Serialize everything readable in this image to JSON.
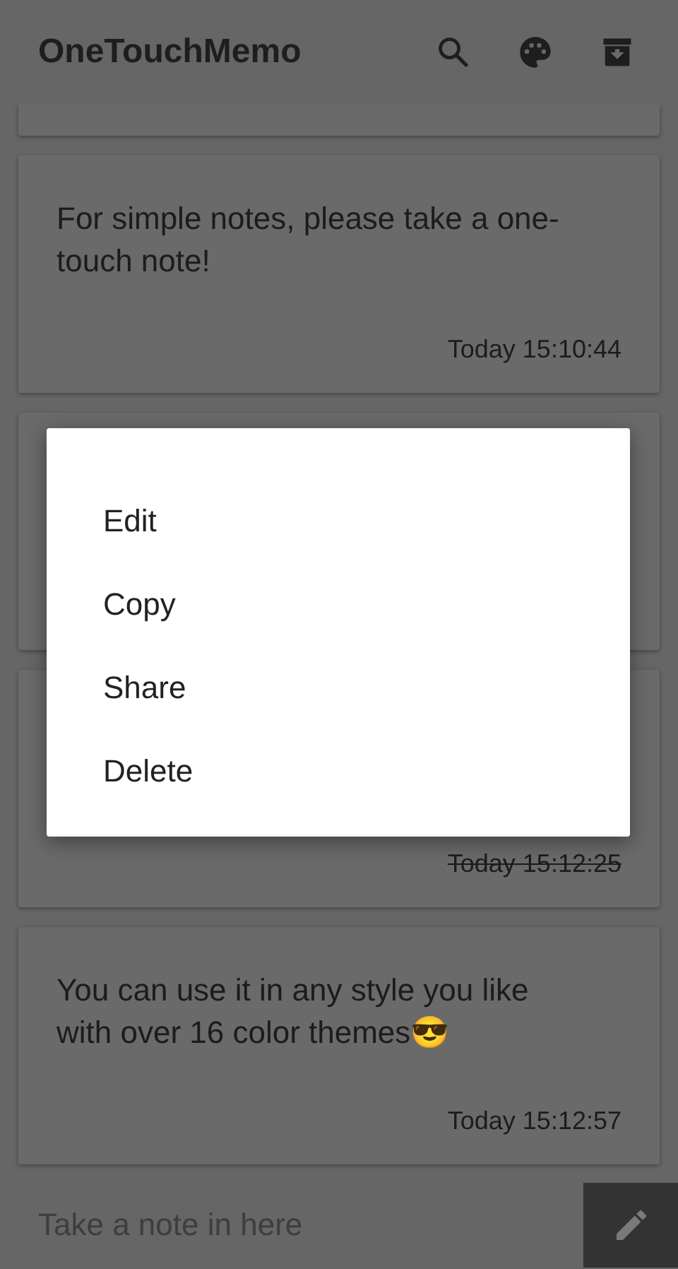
{
  "app_bar": {
    "title": "OneTouchMemo"
  },
  "notes": [
    {
      "kind": "clipped"
    },
    {
      "kind": "full",
      "text": "For simple notes, please take a one-touch note!",
      "time": "Today 15:10:44",
      "done": false
    },
    {
      "kind": "covered"
    },
    {
      "kind": "full",
      "time": "Today 15:12:25",
      "done": true
    },
    {
      "kind": "full",
      "text": "You can use it in any style you like with over 16 color themes😎",
      "time": "Today 15:12:57",
      "done": false
    }
  ],
  "composer": {
    "placeholder": "Take a note in here"
  },
  "context_menu": {
    "items": [
      "Edit",
      "Copy",
      "Share",
      "Delete"
    ]
  }
}
